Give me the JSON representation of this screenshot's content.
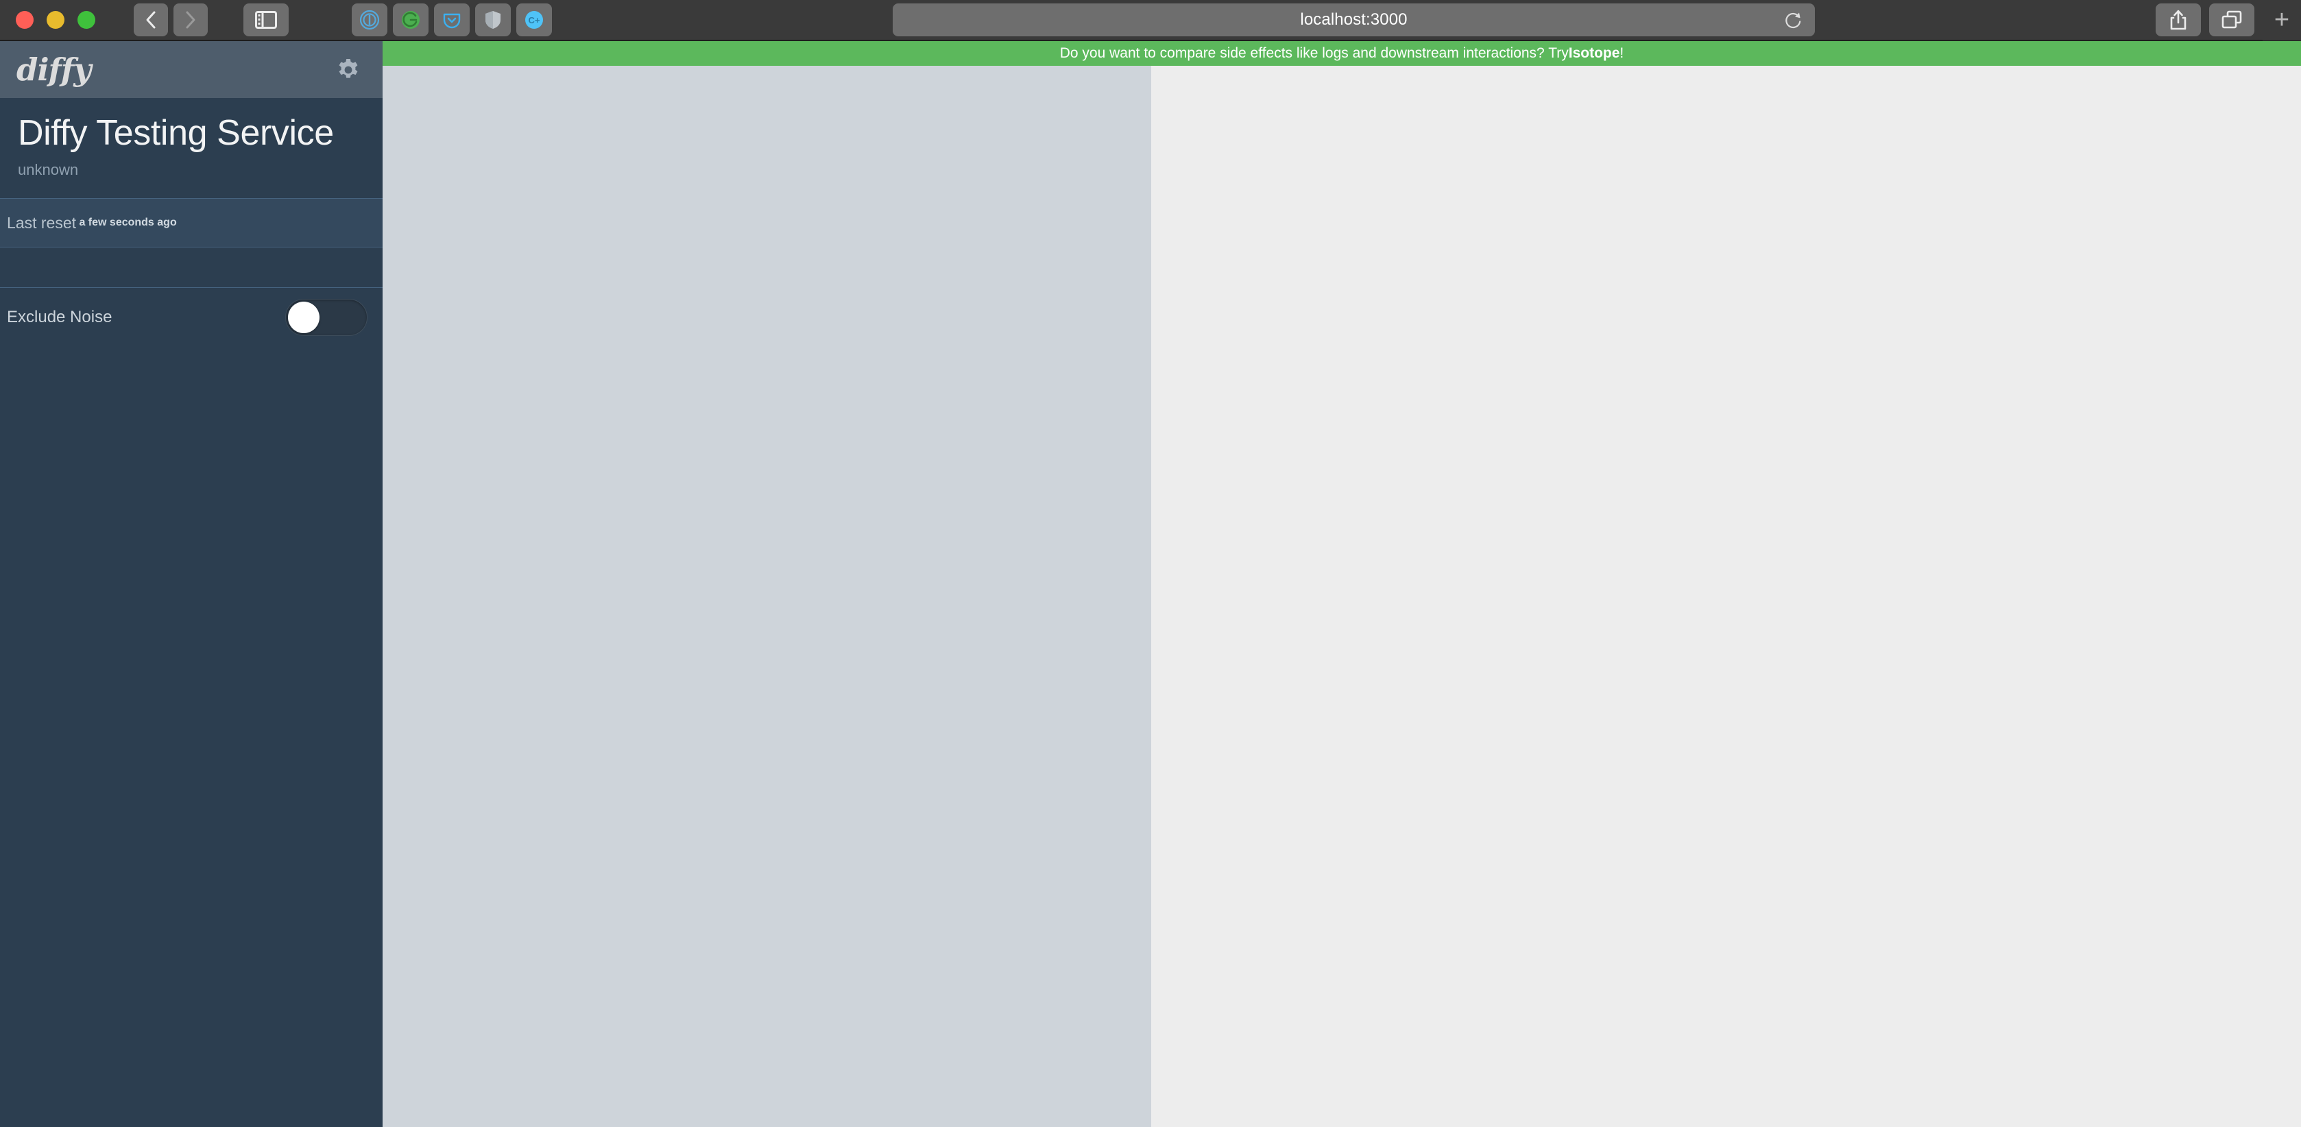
{
  "browser": {
    "traffic_lights": [
      {
        "name": "close",
        "color": "#ff5f57"
      },
      {
        "name": "minimize",
        "color": "#e8bb2d"
      },
      {
        "name": "zoom",
        "color": "#3fc13c"
      }
    ],
    "back_label": "‹",
    "forward_label": "›",
    "sidebar_toggle_icon": "sidebar-icon",
    "extensions": [
      {
        "name": "1password-icon",
        "color": "#4aa8e0"
      },
      {
        "name": "grammarly-icon",
        "color": "#4caf50"
      },
      {
        "name": "pocket-icon",
        "color": "#3bb0f0"
      },
      {
        "name": "shield-icon",
        "color": "#c0c6cb"
      },
      {
        "name": "c-plus-icon",
        "color": "#4fc3f7",
        "glyph": "C+"
      }
    ],
    "address": {
      "value": "localhost:3000",
      "placeholder": "Search or enter website name",
      "reload_icon": "reload-icon"
    },
    "share_icon": "share-icon",
    "tabs_overview_icon": "tab-overview-icon",
    "new_tab_label": "+"
  },
  "banner": {
    "text_before": "Do you want to compare side effects like logs and downstream interactions? Try ",
    "link_label": "Isotope",
    "text_after": "!",
    "background": "#5cb85c",
    "color": "#ffffff"
  },
  "sidebar": {
    "brand": "diffy",
    "settings_icon": "gear-icon",
    "service_title": "Diffy Testing Service",
    "service_subtitle": "unknown",
    "reset": {
      "label": "Last reset",
      "value": "a few seconds ago"
    },
    "exclude_noise": {
      "label": "Exclude Noise",
      "state": "off"
    },
    "background": "#2c3e50",
    "header_background": "#4e5d6c"
  },
  "main": {
    "left_pane_background": "#ced4da",
    "right_pane_background": "#ededed"
  }
}
